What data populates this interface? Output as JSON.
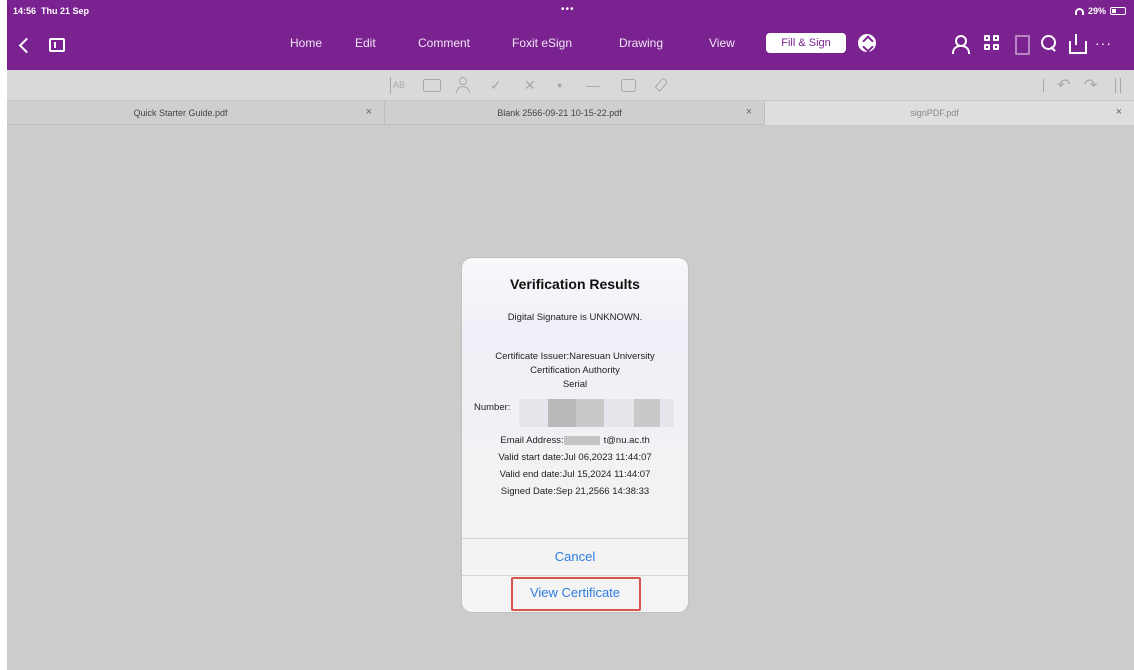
{
  "status": {
    "time": "14:56",
    "day": "Thu 21 Sep",
    "dots": "•••",
    "battery": "29%"
  },
  "nav": {
    "tabs": [
      "Home",
      "Edit",
      "Comment",
      "Foxit eSign",
      "Drawing",
      "View"
    ],
    "active_tab": "Fill & Sign",
    "more": "···"
  },
  "file_tabs": [
    {
      "name": "Quick Starter Guide.pdf",
      "close": "×"
    },
    {
      "name": "Blank 2566-09-21 10-15-22.pdf",
      "close": "×"
    },
    {
      "name": "signPDF.pdf",
      "close": "×"
    }
  ],
  "toolbar": {
    "text_tool": "AB",
    "check_tool": "✓",
    "cross_tool": "✕",
    "dot_tool": "●",
    "line_tool": "—",
    "undo": "↶",
    "redo": "↷"
  },
  "dialog": {
    "title": "Verification Results",
    "status_line": "Digital Signature is UNKNOWN.",
    "issuer_line1": "Certificate Issuer:Naresuan University",
    "issuer_line2": "Certification Authority",
    "serial_label": "Serial",
    "number_label": "Number:",
    "email_label": "Email Address:",
    "email_suffix": "t@nu.ac.th",
    "valid_start": "Valid start date:Jul 06,2023 11:44:07",
    "valid_end": "Valid end date:Jul 15,2024 11:44:07",
    "signed_date": "Signed Date:Sep 21,2566 14:38:33",
    "cancel": "Cancel",
    "view_certificate": "View Certificate"
  },
  "colors": {
    "brand": "#7a2290",
    "link": "#2f7de1",
    "highlight": "#d9534f"
  }
}
